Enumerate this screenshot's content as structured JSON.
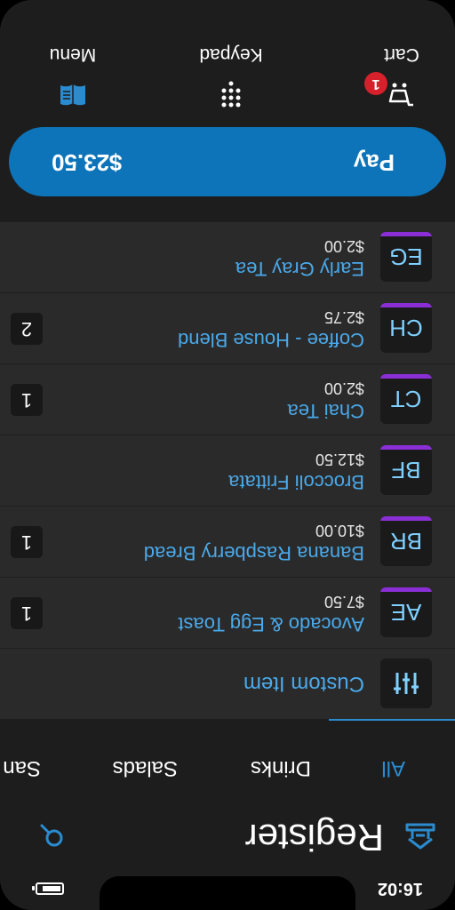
{
  "status_bar": {
    "time": "16:02",
    "battery_level": 0.85
  },
  "header": {
    "title": "Register"
  },
  "tabs": [
    {
      "label": "All",
      "active": true
    },
    {
      "label": "Drinks",
      "active": false
    },
    {
      "label": "Salads",
      "active": false
    },
    {
      "label": "San",
      "active": false
    }
  ],
  "items": [
    {
      "abbr": "",
      "name": "Custom Item",
      "price": "",
      "qty": ""
    },
    {
      "abbr": "AE",
      "name": "Avocado & Egg Toast",
      "price": "$7.50",
      "qty": "1"
    },
    {
      "abbr": "BR",
      "name": "Banana Raspberry Bread",
      "price": "$10.00",
      "qty": "1"
    },
    {
      "abbr": "BF",
      "name": "Broccoli Frittata",
      "price": "$12.50",
      "qty": ""
    },
    {
      "abbr": "CT",
      "name": "Chai Tea",
      "price": "$2.00",
      "qty": "1"
    },
    {
      "abbr": "CH",
      "name": "Coffee - House Blend",
      "price": "$2.75",
      "qty": "2"
    },
    {
      "abbr": "EG",
      "name": "Early Gray Tea",
      "price": "$2.00",
      "qty": ""
    }
  ],
  "pay": {
    "label": "Pay",
    "amount": "$23.50"
  },
  "nav": {
    "cart": {
      "label": "Cart",
      "badge": "1"
    },
    "keypad": {
      "label": "Keypad"
    },
    "menu": {
      "label": "Menu"
    }
  },
  "colors": {
    "accent": "#0d74b9",
    "link": "#4aa9ea",
    "tile_bar": "#8a2fd6",
    "badge": "#d6202b"
  }
}
